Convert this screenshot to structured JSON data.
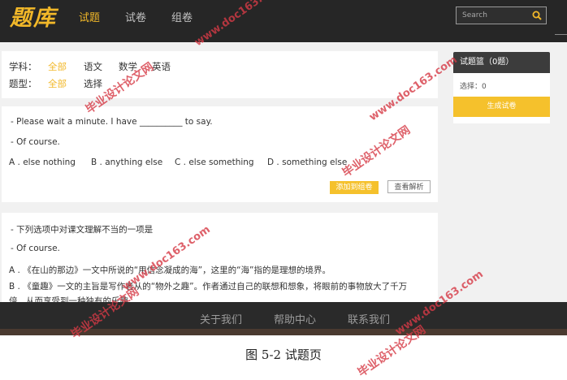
{
  "header": {
    "logo": "题库",
    "nav": [
      {
        "label": "试题",
        "active": true
      },
      {
        "label": "试卷",
        "active": false
      },
      {
        "label": "组卷",
        "active": false
      }
    ],
    "search_placeholder": "Search"
  },
  "filters": {
    "subject_label": "学科：",
    "subjects": [
      {
        "label": "全部",
        "active": true
      },
      {
        "label": "语文",
        "active": false
      },
      {
        "label": "数学",
        "active": false
      },
      {
        "label": "英语",
        "active": false
      }
    ],
    "type_label": "题型：",
    "types": [
      {
        "label": "全部",
        "active": true
      },
      {
        "label": "选择",
        "active": false
      }
    ]
  },
  "questions": [
    {
      "line1": "- Please wait a minute. I have __________ to say.",
      "line2": "- Of course.",
      "options": [
        "A . else nothing",
        "B . anything else",
        "C . else something",
        "D . something else"
      ],
      "add_button": "添加到组卷",
      "view_button": "查看解析"
    },
    {
      "line1": "- 下列选项中对课文理解不当的一项是",
      "line2": "- Of course.",
      "options": [
        "A . 《在山的那边》一文中所说的“用信念凝成的海”，这里的“海”指的是理想的境界。",
        "B . 《童趣》一文的主旨是写作者从的“物外之趣”。作者通过自己的联想和想象，将眼前的事物放大了千万",
        "倍，从而享受到一种独有的乐趣"
      ]
    }
  ],
  "sidebar": {
    "title": "试题篮（0题）",
    "count_text": "选择：0",
    "generate_button": "生成试卷"
  },
  "footer": {
    "links": [
      "关于我们",
      "帮助中心",
      "联系我们"
    ]
  },
  "caption": "图 5-2  试题页",
  "watermarks": [
    "毕业设计论文网",
    "www.doc163.com"
  ],
  "colors": {
    "accent": "#f2b829",
    "header_bg": "#262626",
    "footer_bg": "#2a2a2a",
    "watermark": "#d63a46"
  }
}
